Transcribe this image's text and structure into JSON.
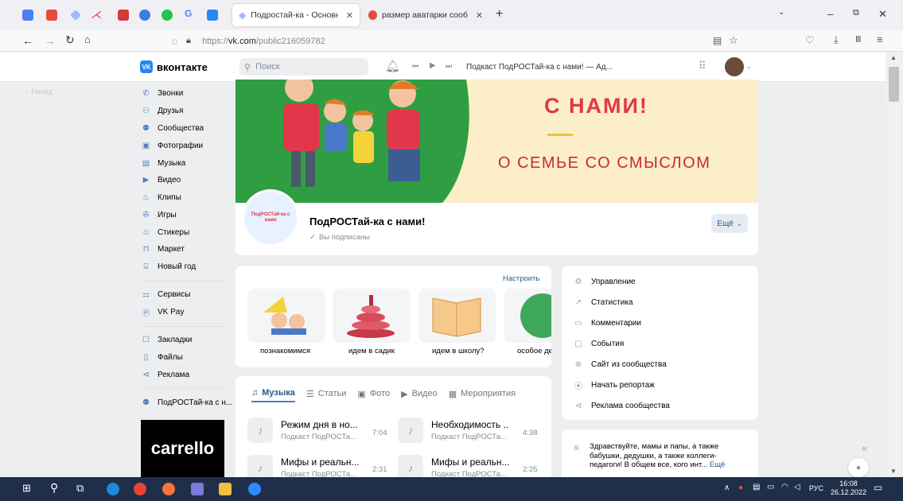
{
  "browser": {
    "tabs": [
      {
        "label": "Подростай-ка - Основные св",
        "active": true
      },
      {
        "label": "размер аватарки сообщества",
        "active": false
      }
    ],
    "new_tab": "+",
    "url_prefix": "https://",
    "url_domain": "vk.com",
    "url_path": "/public216059782"
  },
  "vk": {
    "logo": "вконтакте",
    "search_placeholder": "Поиск",
    "player_track": "Подкаст ПодРОСТай-ка с нами! — Ад...",
    "back": "Назад"
  },
  "left_menu": {
    "group1": [
      "Звонки",
      "Друзья",
      "Сообщества",
      "Фотографии",
      "Музыка",
      "Видео",
      "Клипы",
      "Игры",
      "Стикеры",
      "Маркет",
      "Новый год"
    ],
    "group2": [
      "Сервисы",
      "VK Pay"
    ],
    "group3": [
      "Закладки",
      "Файлы",
      "Реклама"
    ],
    "group4": [
      "ПодРОСТай-ка с н..."
    ],
    "ad_text": "carrello"
  },
  "cover": {
    "line1": "С НАМИ!",
    "line2": "О СЕМЬЕ СО СМЫСЛОМ"
  },
  "community": {
    "avatar_text": "ПодРОСТай-ка с нами",
    "name": "ПодРОСТай-ка с нами!",
    "subscribed": "Вы подписаны",
    "more": "Ещё"
  },
  "stories": {
    "configure": "Настроить",
    "items": [
      "познакомимся",
      "идем в садик",
      "идем в школу?",
      "особое де"
    ]
  },
  "content_tabs": [
    "Музыка",
    "Статьи",
    "Фото",
    "Видео",
    "Мероприятия"
  ],
  "tracks": [
    {
      "title": "Режим дня в но...",
      "sub": "Подкаст ПодРОСТа...",
      "dur": "7:04"
    },
    {
      "title": "Необходимость ...",
      "sub": "Подкаст ПодРОСТа...",
      "dur": "4:38"
    },
    {
      "title": "Мифы и реальн...",
      "sub": "Подкаст ПодРОСТа...",
      "dur": "2:31"
    },
    {
      "title": "Мифы и реальн...",
      "sub": "Подкаст ПодРОСТа...",
      "dur": "2:25"
    }
  ],
  "right_menu": [
    "Управление",
    "Статистика",
    "Комментарии",
    "События",
    "Сайт из сообщества",
    "Начать репортаж",
    "Реклама сообщества"
  ],
  "description": {
    "text": "Здравствуйте, мамы и папы, а также бабушки, дедушки, а также коллеги-педагоги! В общем все, кого инт...",
    "more": "Ещё"
  },
  "taskbar": {
    "lang": "РУС",
    "time": "16:08",
    "date": "26.12.2022"
  },
  "colors": {
    "vk_blue": "#2787f5",
    "cover_green": "#2f9e43",
    "cover_cream": "#fbeec9",
    "cover_red": "#e0374a"
  }
}
